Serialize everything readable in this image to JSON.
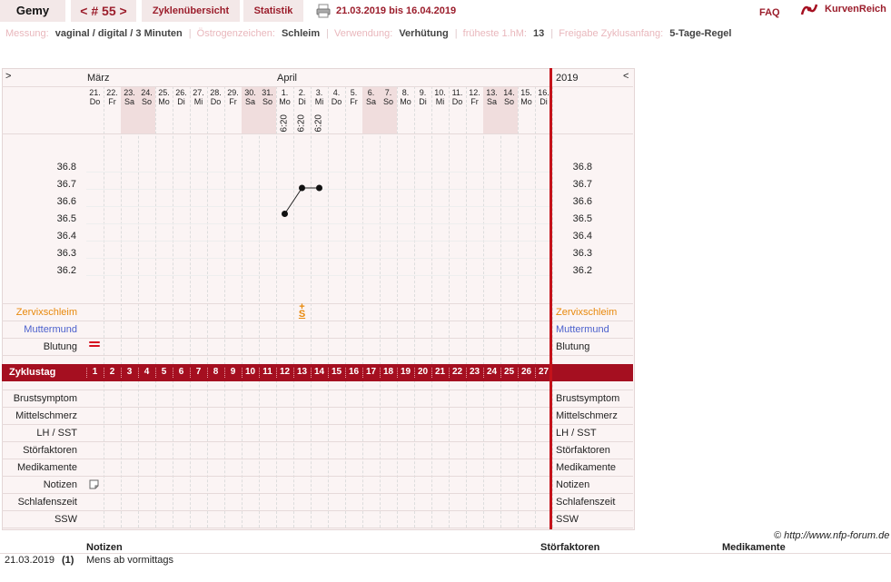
{
  "header": {
    "user_name": "Gemy",
    "cycle_label": "< # 55 >",
    "tab_overview": "Zyklenübersicht",
    "tab_statistics": "Statistik",
    "date_range": "21.03.2019 bis 16.04.2019",
    "faq": "FAQ",
    "brand": "KurvenReich"
  },
  "info": {
    "measure_label": "Messung:",
    "measure_value": "vaginal / digital / 3 Minuten",
    "estrogen_label": "Östrogenzeichen:",
    "estrogen_value": "Schleim",
    "use_label": "Verwendung:",
    "use_value": "Verhütung",
    "earliest_label": "früheste 1.hM:",
    "earliest_value": "13",
    "release_label": "Freigabe Zyklusanfang:",
    "release_value": "5-Tage-Regel"
  },
  "chart": {
    "nav_left": ">",
    "nav_right": "<",
    "month_1": "März",
    "month_2": "April",
    "year": "2019",
    "days": [
      {
        "d": "21.",
        "w": "Do",
        "t": ""
      },
      {
        "d": "22.",
        "w": "Fr",
        "t": ""
      },
      {
        "d": "23.",
        "w": "Sa",
        "t": ""
      },
      {
        "d": "24.",
        "w": "So",
        "t": ""
      },
      {
        "d": "25.",
        "w": "Mo",
        "t": ""
      },
      {
        "d": "26.",
        "w": "Di",
        "t": ""
      },
      {
        "d": "27.",
        "w": "Mi",
        "t": ""
      },
      {
        "d": "28.",
        "w": "Do",
        "t": ""
      },
      {
        "d": "29.",
        "w": "Fr",
        "t": ""
      },
      {
        "d": "30.",
        "w": "Sa",
        "t": ""
      },
      {
        "d": "31.",
        "w": "So",
        "t": ""
      },
      {
        "d": "1.",
        "w": "Mo",
        "t": "6:20"
      },
      {
        "d": "2.",
        "w": "Di",
        "t": "6:20"
      },
      {
        "d": "3.",
        "w": "Mi",
        "t": "6:20"
      },
      {
        "d": "4.",
        "w": "Do",
        "t": ""
      },
      {
        "d": "5.",
        "w": "Fr",
        "t": ""
      },
      {
        "d": "6.",
        "w": "Sa",
        "t": ""
      },
      {
        "d": "7.",
        "w": "So",
        "t": ""
      },
      {
        "d": "8.",
        "w": "Mo",
        "t": ""
      },
      {
        "d": "9.",
        "w": "Di",
        "t": ""
      },
      {
        "d": "10.",
        "w": "Mi",
        "t": ""
      },
      {
        "d": "11.",
        "w": "Do",
        "t": ""
      },
      {
        "d": "12.",
        "w": "Fr",
        "t": ""
      },
      {
        "d": "13.",
        "w": "Sa",
        "t": ""
      },
      {
        "d": "14.",
        "w": "So",
        "t": ""
      },
      {
        "d": "15.",
        "w": "Mo",
        "t": ""
      },
      {
        "d": "16.",
        "w": "Di",
        "t": ""
      }
    ],
    "temps": [
      "36.8",
      "36.7",
      "36.6",
      "36.5",
      "36.4",
      "36.3",
      "36.2"
    ],
    "row_labels_top": [
      "Zervixschleim",
      "Muttermund",
      "Blutung"
    ],
    "cycle_label": "Zyklustag",
    "cycle_days": [
      "1",
      "2",
      "3",
      "4",
      "5",
      "6",
      "7",
      "8",
      "9",
      "10",
      "11",
      "12",
      "13",
      "14",
      "15",
      "16",
      "17",
      "18",
      "19",
      "20",
      "21",
      "22",
      "23",
      "24",
      "25",
      "26",
      "27"
    ],
    "row_labels_bottom": [
      "Brustsymptom",
      "Mittelschmerz",
      "LH / SST",
      "Störfaktoren",
      "Medikamente",
      "Notizen",
      "Schlafenszeit",
      "SSW"
    ],
    "cervix_mark": "S",
    "cervix_mark_top": "+",
    "colors": {
      "cervix": "#e8890c",
      "muttermund": "#4a5fcc",
      "accent": "#a50f20"
    }
  },
  "chart_data": {
    "type": "line",
    "x": [
      "1.",
      "2.",
      "3."
    ],
    "values": [
      36.55,
      36.7,
      36.7
    ],
    "ylim": [
      36.2,
      36.8
    ]
  },
  "footer": {
    "copyright": "© http://www.nfp-forum.de",
    "col_notes": "Notizen",
    "col_disturb": "Störfaktoren",
    "col_med": "Medikamente",
    "row_date": "21.03.2019",
    "row_num": "(1)",
    "row_note": "Mens ab vormittags"
  }
}
